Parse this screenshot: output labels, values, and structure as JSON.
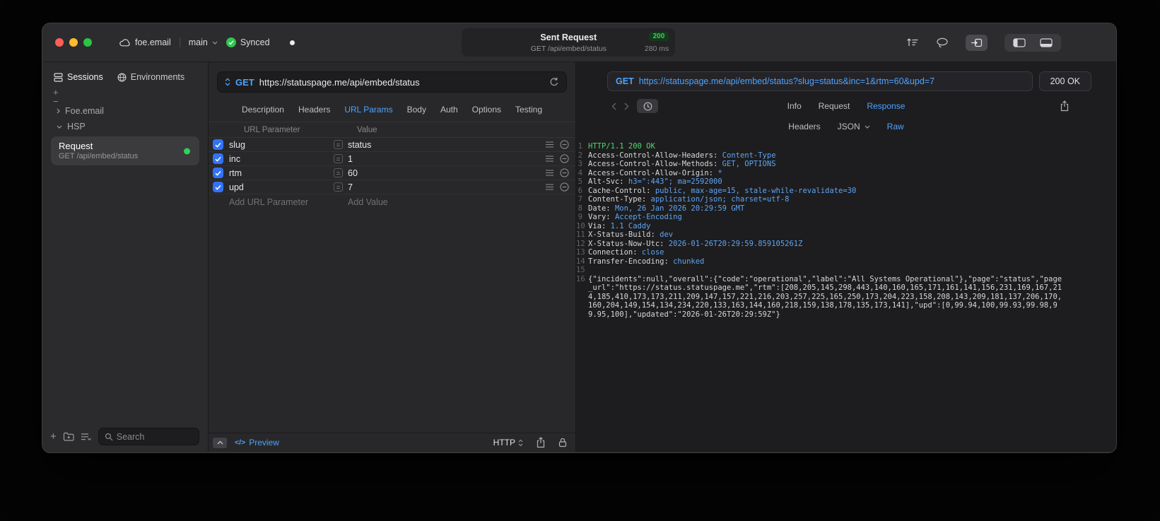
{
  "titlebar": {
    "account": "foe.email",
    "branch": "main",
    "sync_label": "Synced",
    "request_title": "Sent Request",
    "status_badge": "200",
    "request_subtitle": "GET /api/embed/status",
    "duration": "280 ms"
  },
  "icons": {
    "plus": "+",
    "minus": "−",
    "equals": "=",
    "code": "</>"
  },
  "sidebar": {
    "tab_sessions": "Sessions",
    "tab_environments": "Environments",
    "group_1": "Foe.email",
    "group_2": "HSP",
    "request": {
      "title": "Request",
      "subtitle": "GET /api/embed/status"
    },
    "search_placeholder": "Search"
  },
  "request_panel": {
    "method": "GET",
    "url": "https://statuspage.me/api/embed/status",
    "tabs": [
      "Description",
      "Headers",
      "URL Params",
      "Body",
      "Auth",
      "Options",
      "Testing"
    ],
    "active_tab": "URL Params",
    "param_table": {
      "col_name": "URL Parameter",
      "col_value": "Value",
      "rows": [
        {
          "name": "slug",
          "value": "status",
          "enabled": true
        },
        {
          "name": "inc",
          "value": "1",
          "enabled": true
        },
        {
          "name": "rtm",
          "value": "60",
          "enabled": true
        },
        {
          "name": "upd",
          "value": "7",
          "enabled": true
        }
      ],
      "add_name_placeholder": "Add URL Parameter",
      "add_value_placeholder": "Add Value"
    },
    "footer": {
      "preview_label": "Preview",
      "protocol": "HTTP"
    }
  },
  "response_panel": {
    "method": "GET",
    "url": "https://statuspage.me/api/embed/status?slug=status&inc=1&rtm=60&upd=7",
    "status": "200 OK",
    "tabs": [
      "Info",
      "Request",
      "Response"
    ],
    "active_tab": "Response",
    "subtabs": [
      "Headers",
      "JSON",
      "Raw"
    ],
    "active_subtab": "Raw",
    "raw": {
      "status_line": "HTTP/1.1 200 OK",
      "headers": [
        {
          "name": "Access-Control-Allow-Headers",
          "value": "Content-Type"
        },
        {
          "name": "Access-Control-Allow-Methods",
          "value": "GET, OPTIONS"
        },
        {
          "name": "Access-Control-Allow-Origin",
          "value": "*"
        },
        {
          "name": "Alt-Svc",
          "value": "h3=\":443\"; ma=2592000"
        },
        {
          "name": "Cache-Control",
          "value": "public, max-age=15, stale-while-revalidate=30"
        },
        {
          "name": "Content-Type",
          "value": "application/json; charset=utf-8"
        },
        {
          "name": "Date",
          "value": "Mon, 26 Jan 2026 20:29:59 GMT"
        },
        {
          "name": "Vary",
          "value": "Accept-Encoding"
        },
        {
          "name": "Via",
          "value": "1.1 Caddy"
        },
        {
          "name": "X-Status-Build",
          "value": "dev"
        },
        {
          "name": "X-Status-Now-Utc",
          "value": "2026-01-26T20:29:59.859105261Z"
        },
        {
          "name": "Connection",
          "value": "close"
        },
        {
          "name": "Transfer-Encoding",
          "value": "chunked"
        }
      ],
      "body": "{\"incidents\":null,\"overall\":{\"code\":\"operational\",\"label\":\"All Systems Operational\"},\"page\":\"status\",\"page_url\":\"https://status.statuspage.me\",\"rtm\":[208,205,145,298,443,140,160,165,171,161,141,156,231,169,167,214,185,410,173,173,211,209,147,157,221,216,203,257,225,165,250,173,204,223,158,208,143,209,181,137,206,170,160,204,149,154,134,234,220,133,163,144,160,218,159,138,178,135,173,141],\"upd\":[0,99.94,100,99.93,99.98,99.95,100],\"updated\":\"2026-01-26T20:29:59Z\"}"
    }
  },
  "colors": {
    "accent_blue": "#4da3ff",
    "green": "#30d158",
    "checkbox_blue": "#3273f5"
  }
}
